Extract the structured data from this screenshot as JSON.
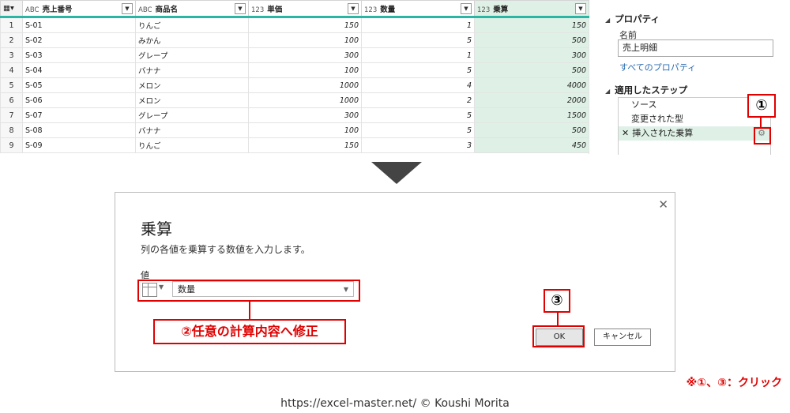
{
  "grid": {
    "columns": [
      {
        "type": "ABC",
        "name": "売上番号"
      },
      {
        "type": "ABC",
        "name": "商品名"
      },
      {
        "type": "123",
        "name": "単価"
      },
      {
        "type": "123",
        "name": "数量"
      },
      {
        "type": "123",
        "name": "乗算"
      }
    ],
    "rows": [
      [
        "1",
        "S-01",
        "りんご",
        "150",
        "1",
        "150"
      ],
      [
        "2",
        "S-02",
        "みかん",
        "100",
        "5",
        "500"
      ],
      [
        "3",
        "S-03",
        "グレープ",
        "300",
        "1",
        "300"
      ],
      [
        "4",
        "S-04",
        "バナナ",
        "100",
        "5",
        "500"
      ],
      [
        "5",
        "S-05",
        "メロン",
        "1000",
        "4",
        "4000"
      ],
      [
        "6",
        "S-06",
        "メロン",
        "1000",
        "2",
        "2000"
      ],
      [
        "7",
        "S-07",
        "グレープ",
        "300",
        "5",
        "1500"
      ],
      [
        "8",
        "S-08",
        "バナナ",
        "100",
        "5",
        "500"
      ],
      [
        "9",
        "S-09",
        "りんご",
        "150",
        "3",
        "450"
      ]
    ]
  },
  "pane": {
    "properties_header": "プロパティ",
    "name_label": "名前",
    "name_value": "売上明細",
    "all_properties_link": "すべてのプロパティ",
    "steps_header": "適用したステップ",
    "steps": [
      "ソース",
      "変更された型",
      "挿入された乗算"
    ],
    "callout_1": "①"
  },
  "dialog": {
    "title": "乗算",
    "description": "列の各値を乗算する数値を入力します。",
    "value_label": "値",
    "value_field": "数量",
    "ok_label": "OK",
    "cancel_label": "キャンセル",
    "callout_2": "②任意の計算内容へ修正",
    "callout_3": "③"
  },
  "note": "※①、③：クリック",
  "credit": "https://excel-master.net/  © Koushi Morita",
  "colors": {
    "accent": "#e00000",
    "highlight": "#dff1e6",
    "teal": "#2bb5a4"
  }
}
